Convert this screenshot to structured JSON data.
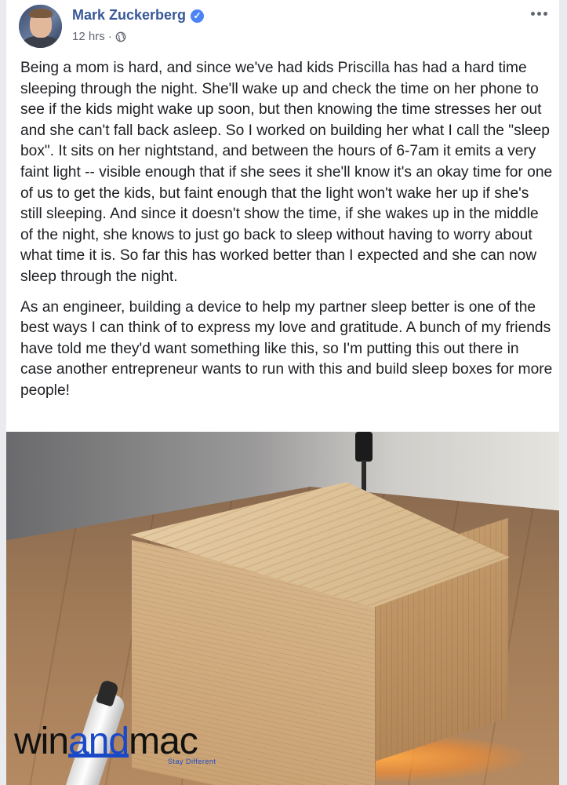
{
  "post": {
    "author": "Mark Zuckerberg",
    "timestamp": "12 hrs",
    "separator": "·",
    "privacy_icon": "globe-icon",
    "more_icon": "more-options-icon",
    "verified_icon": "verified-badge-icon",
    "paragraphs": [
      "Being a mom is hard, and since we've had kids Priscilla has had a hard time sleeping through the night. She'll wake up and check the time on her phone to see if the kids might wake up soon, but then knowing the time stresses her out and she can't fall back asleep. So I worked on building her what I call the \"sleep box\". It sits on her nightstand, and between the hours of 6-7am it emits a very faint light -- visible enough that if she sees it she'll know it's an okay time for one of us to get the kids, but faint enough that the light won't wake her up if she's still sleeping. And since it doesn't show the time, if she wakes up in the middle of the night, she knows to just go back to sleep without having to worry about what time it is. So far this has worked better than I expected and she can now sleep through the night.",
      "As an engineer, building a device to help my partner sleep better is one of the best ways I can think of to express my love and gratitude. A bunch of my friends have told me they'd want something like this, so I'm putting this out there in case another entrepreneur wants to run with this and build sleep boxes for more people!"
    ]
  },
  "watermark": {
    "part1": "win",
    "part2": "and",
    "part3": "mac",
    "tagline": "Stay Different"
  },
  "colors": {
    "author": "#385898",
    "text": "#1c1e21",
    "meta": "#616770",
    "verified": "#4c84f5",
    "watermark_accent": "#1a49c8"
  }
}
